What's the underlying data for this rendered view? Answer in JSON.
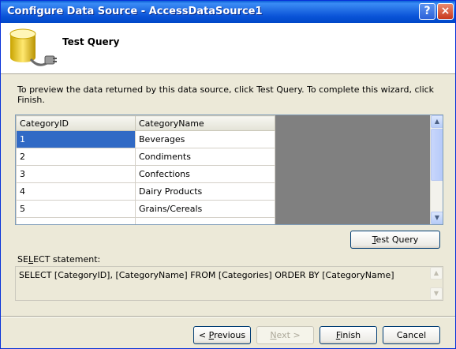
{
  "window": {
    "title": "Configure Data Source - AccessDataSource1",
    "help_glyph": "?",
    "close_glyph": "×"
  },
  "header": {
    "title": "Test Query"
  },
  "instructions": "To preview the data returned by this data source, click Test Query. To complete this wizard, click Finish.",
  "grid": {
    "columns": [
      "CategoryID",
      "CategoryName"
    ],
    "rows": [
      [
        "1",
        "Beverages"
      ],
      [
        "2",
        "Condiments"
      ],
      [
        "3",
        "Confections"
      ],
      [
        "4",
        "Dairy Products"
      ],
      [
        "5",
        "Grains/Cereals"
      ]
    ],
    "selected_row": 0
  },
  "test_query_button": {
    "label_pre": "",
    "label_u": "T",
    "label_post": "est Query"
  },
  "select_statement": {
    "label_pre": "SE",
    "label_u": "L",
    "label_post": "ECT statement:",
    "sql": "SELECT [CategoryID], [CategoryName] FROM [Categories] ORDER BY [CategoryName]"
  },
  "footer": {
    "previous": {
      "label_pre": "< ",
      "label_u": "P",
      "label_post": "revious"
    },
    "next": {
      "label_pre": "",
      "label_u": "N",
      "label_post": "ext >"
    },
    "finish": {
      "label_pre": "",
      "label_u": "F",
      "label_post": "inish"
    },
    "cancel": {
      "label": "Cancel"
    }
  },
  "icons": {
    "header_icon": "database-plug-icon",
    "scroll_up": "arrow-up-icon",
    "scroll_down": "arrow-down-icon"
  },
  "colors": {
    "titlebar": "#0a54d8",
    "selection": "#316ac5",
    "dialog_bg": "#ece9d8"
  }
}
